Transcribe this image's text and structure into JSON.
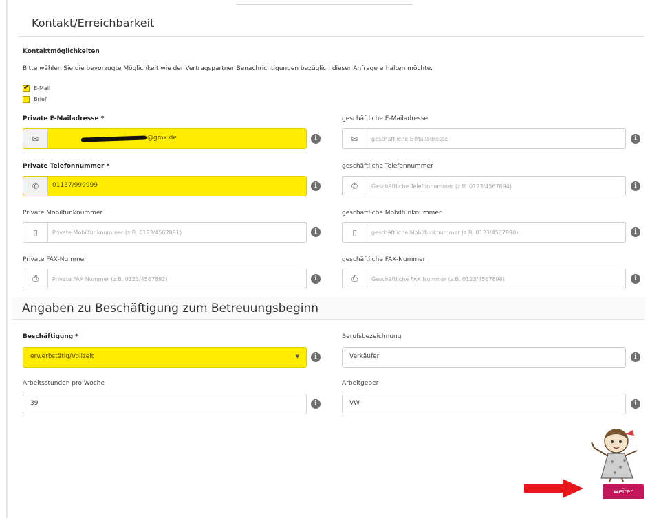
{
  "contact_section": {
    "title": "Kontakt/Erreichbarkeit",
    "options_label": "Kontaktmöglichkeiten",
    "instructions": "Bitte wählen Sie die bevorzugte Möglichkeit wie der Vertragspartner Benachrichtigungen bezüglich dieser Anfrage erhalten möchte.",
    "options": [
      {
        "label": "E-Mail",
        "checked": true
      },
      {
        "label": "Brief",
        "checked": false
      }
    ],
    "fields": {
      "private_email": {
        "label": "Private E-Mailadresse *",
        "value": "@gmx.de",
        "icon": "envelope-icon"
      },
      "business_email": {
        "label": "geschäftliche E-Mailadresse",
        "placeholder": "geschäftliche E-Mailadresse",
        "icon": "envelope-icon"
      },
      "private_phone": {
        "label": "Private Telefonnummer *",
        "value": "01137/999999",
        "icon": "phone-icon"
      },
      "business_phone": {
        "label": "geschäftliche Telefonnummer",
        "placeholder": "Geschäftliche Telefonnummer (z.B. 0123/4567894)",
        "icon": "phone-icon"
      },
      "private_mobile": {
        "label": "Private Mobilfunknummer",
        "placeholder": "Private Mobilfunknummer (z.B. 0123/4567891)",
        "icon": "mobile-icon"
      },
      "business_mobile": {
        "label": "geschäftliche Mobilfunknummer",
        "placeholder": "geschäftliche Mobilfunknummer (z.B. 0123/4567890)",
        "icon": "mobile-icon"
      },
      "private_fax": {
        "label": "Private FAX-Nummer",
        "placeholder": "Private FAX Nummer (z.B. 0123/4567892)",
        "icon": "fax-icon"
      },
      "business_fax": {
        "label": "geschäftliche FAX-Nummer",
        "placeholder": "Geschäftliche FAX Nummer (z.B. 0123/4567898)",
        "icon": "fax-icon"
      }
    }
  },
  "employment_section": {
    "title": "Angaben zu Beschäftigung zum Betreuungsbeginn",
    "fields": {
      "employment": {
        "label": "Beschäftigung *",
        "value": "erwerbstätig/Vollzeit"
      },
      "job_title": {
        "label": "Berufsbezeichnung",
        "value": "Verkäufer"
      },
      "hours": {
        "label": "Arbeitsstunden pro Woche",
        "value": "39"
      },
      "employer": {
        "label": "Arbeitgeber",
        "value": "VW"
      }
    }
  },
  "actions": {
    "next_label": "weiter"
  },
  "colors": {
    "highlight": "#ffec00",
    "button": "#c2185b",
    "arrow": "#e8161b"
  }
}
